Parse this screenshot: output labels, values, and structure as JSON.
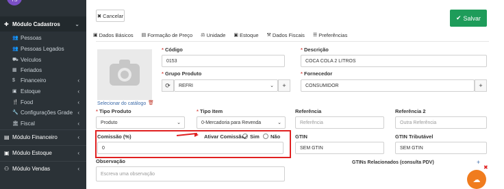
{
  "sidebar": {
    "avatar": "TS",
    "module_cadastros": "Módulo Cadastros",
    "items": [
      {
        "icon": "users-icon",
        "label": "Pessoas"
      },
      {
        "icon": "users-icon",
        "label": "Pessoas Legados"
      },
      {
        "icon": "car-icon",
        "label": "Veículos"
      },
      {
        "icon": "calendar-icon",
        "label": "Feriados"
      },
      {
        "icon": "dollar-icon",
        "label": "Financeiro"
      },
      {
        "icon": "box-icon",
        "label": "Estoque"
      },
      {
        "icon": "food-icon",
        "label": "Food"
      },
      {
        "icon": "wrench-icon",
        "label": "Configurações Grade"
      },
      {
        "icon": "bank-icon",
        "label": "Fiscal"
      }
    ],
    "module_financeiro": "Módulo Financeiro",
    "module_estoque": "Módulo Estoque",
    "module_vendas": "Módulo Vendas"
  },
  "toolbar": {
    "cancel_label": "Cancelar",
    "save_label": "Salvar"
  },
  "tabs": [
    "Dados Básicos",
    "Formação de Preço",
    "Unidade",
    "Estoque",
    "Dados Fiscais",
    "Preferências"
  ],
  "image": {
    "select_catalog": "Selecionar do catálogo"
  },
  "form": {
    "codigo_label": "Código",
    "codigo_value": "0153",
    "descricao_label": "Descrição",
    "descricao_value": "COCA COLA 2 LITROS",
    "grupo_label": "Grupo Produto",
    "grupo_value": "REFRI",
    "fornecedor_label": "Fornecedor",
    "fornecedor_value": "CONSUMIDOR",
    "tipo_produto_label": "Tipo Produto",
    "tipo_produto_value": "Produto",
    "tipo_item_label": "Tipo Item",
    "tipo_item_value": "0-Mercadoria para Revenda",
    "referencia_label": "Referência",
    "referencia_placeholder": "Referência",
    "referencia2_label": "Referência 2",
    "referencia2_placeholder": "Outra Referência",
    "comissao_label": "Comissão (%)",
    "comissao_value": "0",
    "ativar_comissao_label": "Ativar Comissão?",
    "sim_label": "Sim",
    "nao_label": "Não",
    "gtin_label": "GTIN",
    "gtin_value": "SEM GTIN",
    "gtin_trib_label": "GTIN Tributável",
    "gtin_trib_value": "SEM GTIN",
    "observacao_label": "Observação",
    "observacao_placeholder": "Escreva uma observação",
    "gtins_relacionados_label": "GTINs Relacionados (consulta PDV)"
  },
  "colors": {
    "sidebar_bg": "#2b3237",
    "save_green": "#1e9c5a",
    "highlight_red": "#e02020",
    "chat_orange": "#f07c1e"
  }
}
